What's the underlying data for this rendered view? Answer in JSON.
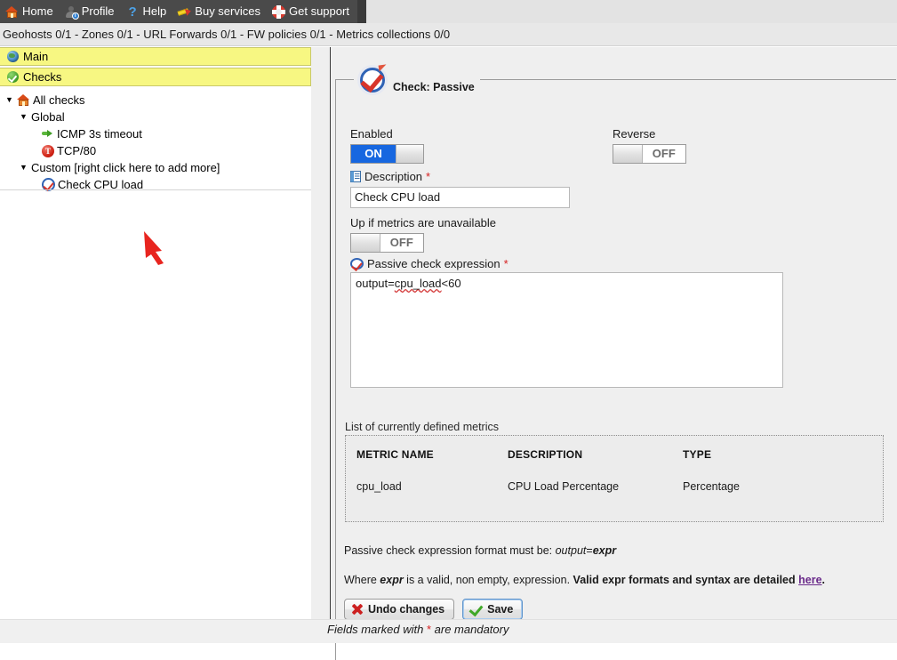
{
  "topnav": {
    "items": [
      {
        "label": "Home",
        "icon": "home-icon"
      },
      {
        "label": "Profile",
        "icon": "person-icon"
      },
      {
        "label": "Help",
        "icon": "question-icon",
        "glyph": "?"
      },
      {
        "label": "Buy services",
        "icon": "pencil-icon"
      },
      {
        "label": "Get support",
        "icon": "lifebuoy-icon"
      }
    ]
  },
  "statusline": {
    "text": "Geohosts 0/1 - Zones 0/1 - URL Forwards 0/1 - FW policies 0/1 - Metrics collections 0/0"
  },
  "sidebar": {
    "menu": [
      {
        "label": "Main",
        "icon": "globe-icon"
      },
      {
        "label": "Checks",
        "icon": "green-check-icon"
      }
    ],
    "tree": [
      {
        "label": "All checks",
        "icon": "house-icon",
        "arrow": "▼",
        "indent": 0
      },
      {
        "label": "Global",
        "icon": "none",
        "arrow": "▼",
        "indent": 1
      },
      {
        "label": "ICMP 3s timeout",
        "icon": "green-arrow-icon",
        "arrow": "",
        "indent": 2
      },
      {
        "label": "TCP/80",
        "icon": "tcp-icon",
        "glyph": "T",
        "arrow": "",
        "indent": 2
      },
      {
        "label": "Custom [right click here to add more]",
        "icon": "none",
        "arrow": "▼",
        "indent": 1
      },
      {
        "label": "Check CPU load",
        "icon": "check-circle-icon",
        "arrow": "",
        "indent": 2
      }
    ]
  },
  "form": {
    "legend": "Check: Passive",
    "legend_icon": "check-circle-icon",
    "enabled": {
      "label": "Enabled",
      "value": "ON",
      "state": "on"
    },
    "reverse": {
      "label": "Reverse",
      "value": "OFF",
      "state": "off"
    },
    "description": {
      "label": "Description",
      "required_mark": "*",
      "icon": "document-icon",
      "value": "Check CPU load"
    },
    "up_if_unavailable": {
      "label": "Up if metrics are unavailable",
      "value": "OFF",
      "state": "off"
    },
    "expression": {
      "label": "Passive check expression",
      "required_mark": "*",
      "icon": "check-circle-icon",
      "value_prefix": "output=",
      "value_misspelled": "cpu_load",
      "value_suffix": "<60",
      "value": "output=cpu_load<60"
    },
    "metrics": {
      "caption": "List of currently defined metrics",
      "columns": [
        "METRIC NAME",
        "DESCRIPTION",
        "TYPE"
      ],
      "rows": [
        [
          "cpu_load",
          "CPU Load Percentage",
          "Percentage"
        ]
      ]
    },
    "notes": {
      "note1_prefix": "Passive check expression format must be: ",
      "note1_italic": "output",
      "note1_eq": "=",
      "note1_bolditalic": "expr",
      "note2_where": "Where ",
      "note2_expr": "expr",
      "note2_mid": " is a valid, non empty, expression. ",
      "note2_bold": "Valid expr formats and syntax are detailed ",
      "note2_link": "here",
      "note2_end": "."
    },
    "buttons": {
      "undo": {
        "label": "Undo changes",
        "icon": "red-x-icon"
      },
      "save": {
        "label": "Save",
        "icon": "green-check-icon",
        "focused": true
      }
    }
  },
  "footer": {
    "prefix": "Fields marked with ",
    "star": "*",
    "suffix": " are mandatory"
  },
  "colors": {
    "nav_bg": "#4a4a4a",
    "menu_highlight": "#f7f782",
    "toggle_on": "#1767e0",
    "required": "#d62020",
    "link": "#6a2a8a",
    "panel_bg": "#efefef"
  }
}
